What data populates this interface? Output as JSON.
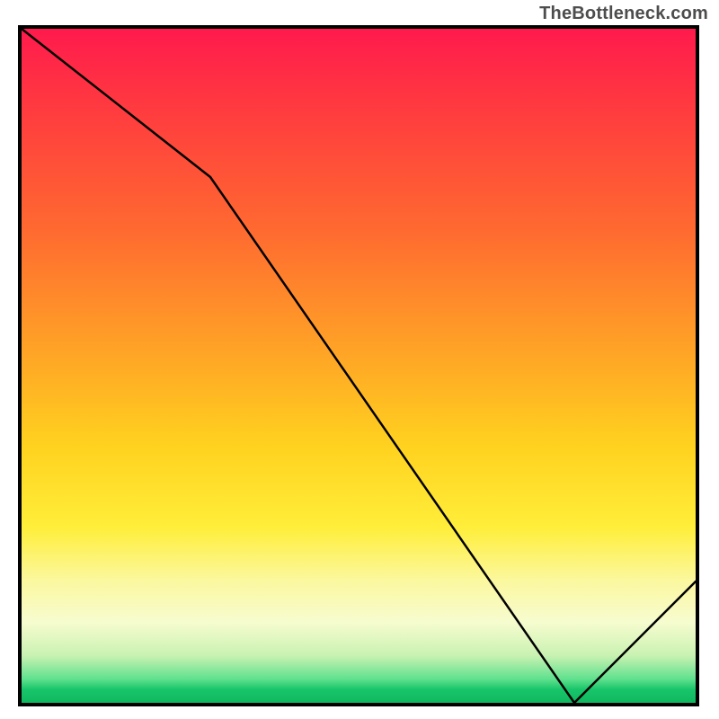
{
  "watermark": "TheBottleneck.com",
  "tiny_label": "",
  "chart_data": {
    "type": "line",
    "title": "",
    "xlabel": "",
    "ylabel": "",
    "xlim": [
      0,
      100
    ],
    "ylim": [
      0,
      100
    ],
    "series": [
      {
        "name": "curve",
        "x": [
          0,
          28,
          82,
          100
        ],
        "y": [
          100,
          78,
          0,
          18
        ]
      }
    ],
    "background_gradient": {
      "direction": "vertical",
      "stops": [
        {
          "pos": 0.0,
          "color": "#ff1a4d"
        },
        {
          "pos": 0.3,
          "color": "#ff6a30"
        },
        {
          "pos": 0.62,
          "color": "#ffd21f"
        },
        {
          "pos": 0.82,
          "color": "#fbf8a0"
        },
        {
          "pos": 0.96,
          "color": "#5fe08e"
        },
        {
          "pos": 1.0,
          "color": "#0eb85f"
        }
      ]
    },
    "marker": {
      "x": 82,
      "y": 0,
      "label": ""
    }
  }
}
